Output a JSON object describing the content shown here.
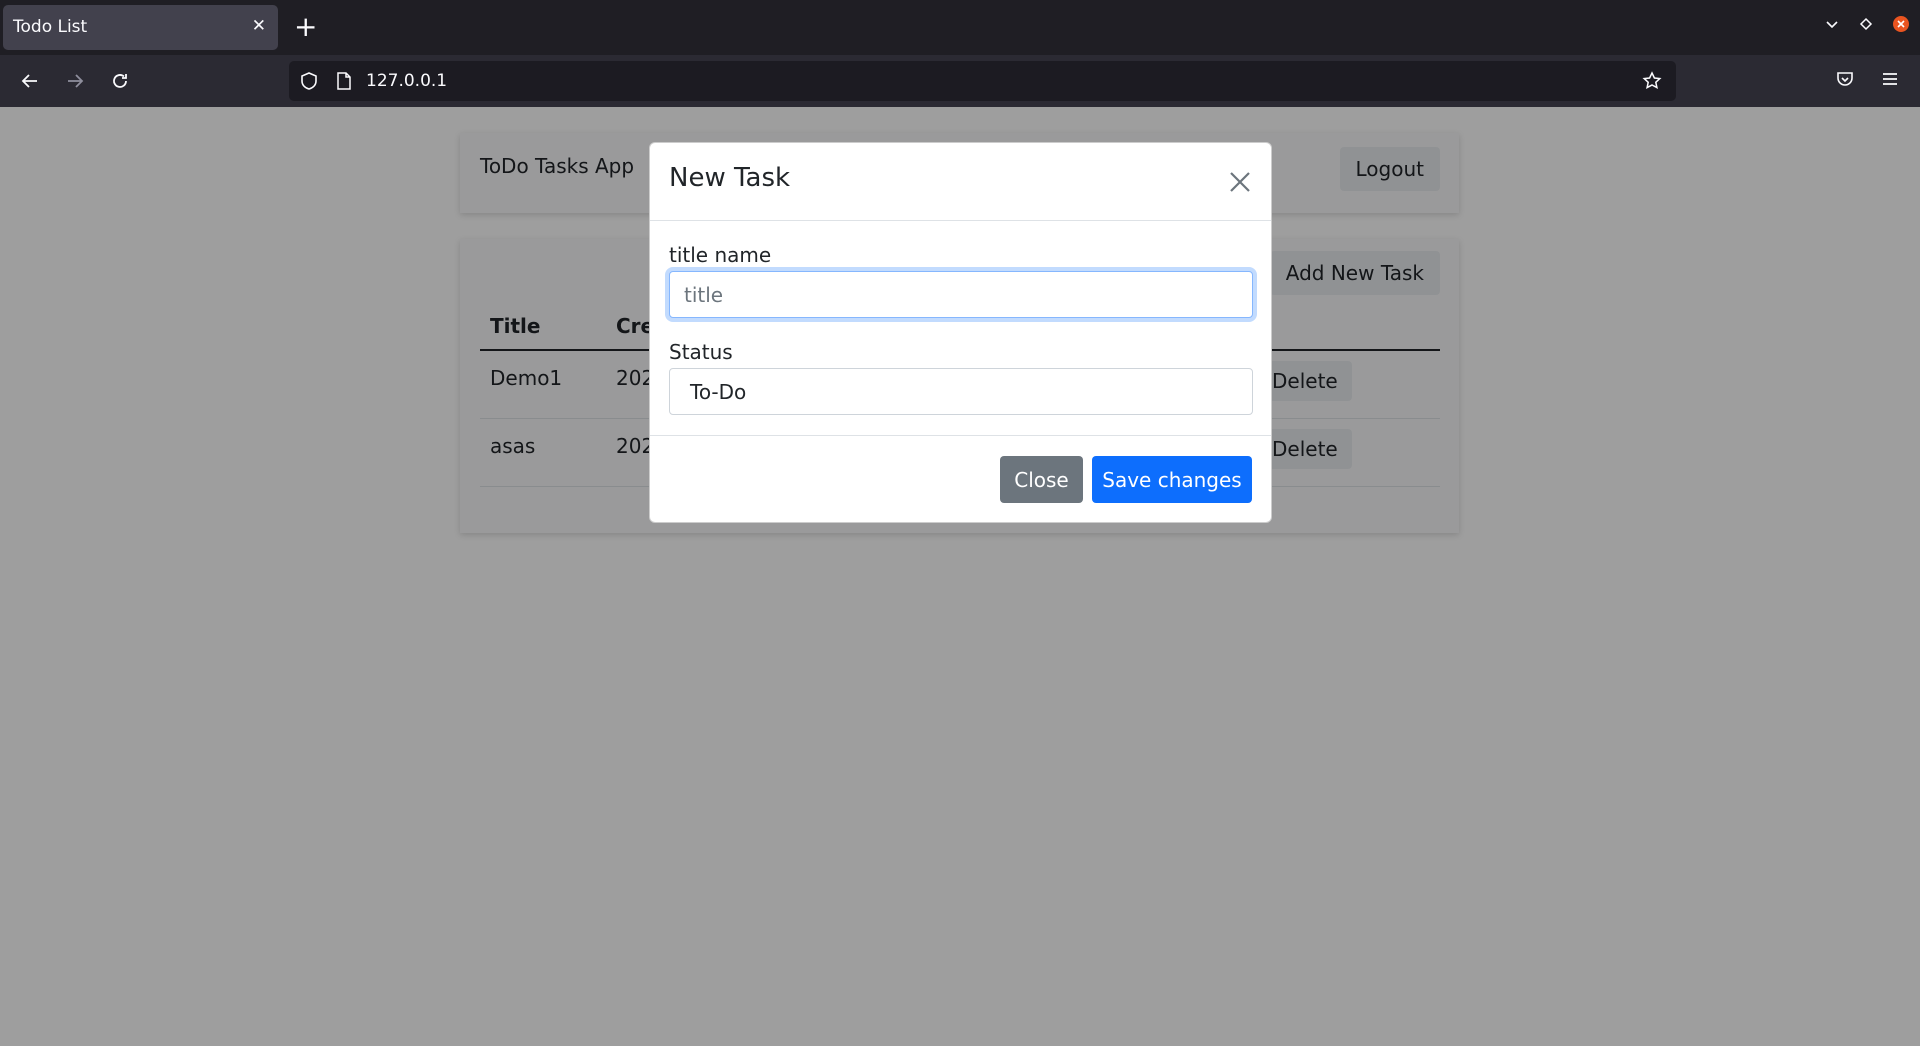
{
  "browser": {
    "tab_title": "Todo List",
    "url": "127.0.0.1"
  },
  "app": {
    "name": "ToDo Tasks App",
    "logout_label": "Logout",
    "add_task_label": "Add New Task"
  },
  "table": {
    "columns": [
      "Title",
      "Cre"
    ],
    "rows": [
      {
        "title": "Demo1",
        "created": "202",
        "delete_label": "Delete"
      },
      {
        "title": "asas",
        "created": "202",
        "delete_label": "Delete"
      }
    ]
  },
  "modal": {
    "title": "New Task",
    "title_label": "title name",
    "title_placeholder": "title",
    "status_label": "Status",
    "status_value": "To-Do",
    "close_label": "Close",
    "save_label": "Save changes"
  },
  "colors": {
    "primary": "#0d6efd",
    "secondary": "#6c757d"
  }
}
